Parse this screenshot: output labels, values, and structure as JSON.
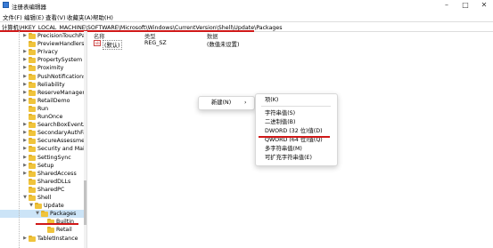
{
  "window": {
    "title": "注册表编辑器",
    "min": "–",
    "max": "□",
    "close": "✕"
  },
  "menu": [
    "文件(F)",
    "编辑(E)",
    "查看(V)",
    "收藏夹(A)",
    "帮助(H)"
  ],
  "address": "计算机\\HKEY_LOCAL_MACHINE\\SOFTWARE\\Microsoft\\Windows\\CurrentVersion\\Shell\\Update\\Packages",
  "tree": [
    {
      "label": "PrecisionTouchPad",
      "level": 3,
      "expandable": true
    },
    {
      "label": "PreviewHandlers",
      "level": 3,
      "expandable": false
    },
    {
      "label": "Privacy",
      "level": 3,
      "expandable": true
    },
    {
      "label": "PropertySystem",
      "level": 3,
      "expandable": true
    },
    {
      "label": "Proximity",
      "level": 3,
      "expandable": true
    },
    {
      "label": "PushNotifications",
      "level": 3,
      "expandable": true
    },
    {
      "label": "Reliability",
      "level": 3,
      "expandable": true
    },
    {
      "label": "ReserveManager",
      "level": 3,
      "expandable": true
    },
    {
      "label": "RetailDemo",
      "level": 3,
      "expandable": true
    },
    {
      "label": "Run",
      "level": 3,
      "expandable": false
    },
    {
      "label": "RunOnce",
      "level": 3,
      "expandable": false
    },
    {
      "label": "SearchBoxEventArgs",
      "level": 3,
      "expandable": true
    },
    {
      "label": "SecondaryAuthFactor",
      "level": 3,
      "expandable": true
    },
    {
      "label": "SecureAssessment",
      "level": 3,
      "expandable": true
    },
    {
      "label": "Security and Maint",
      "level": 3,
      "expandable": true
    },
    {
      "label": "SettingSync",
      "level": 3,
      "expandable": true
    },
    {
      "label": "Setup",
      "level": 3,
      "expandable": true
    },
    {
      "label": "SharedAccess",
      "level": 3,
      "expandable": true
    },
    {
      "label": "SharedDLLs",
      "level": 3,
      "expandable": false
    },
    {
      "label": "SharedPC",
      "level": 3,
      "expandable": false
    },
    {
      "label": "Shell",
      "level": 3,
      "expandable": true,
      "expanded": true
    },
    {
      "label": "Update",
      "level": 4,
      "expandable": true,
      "expanded": true
    },
    {
      "label": "Packages",
      "level": 5,
      "expandable": true,
      "expanded": true,
      "selected": true
    },
    {
      "label": "Builtin",
      "level": 6,
      "expandable": false
    },
    {
      "label": "Retail",
      "level": 6,
      "expandable": false
    },
    {
      "label": "TabletInstance",
      "level": 3,
      "expandable": true
    }
  ],
  "columns": [
    "名称",
    "类型",
    "数据"
  ],
  "values": [
    {
      "name": "(默认)",
      "type": "REG_SZ",
      "data": "(数值未设置)"
    }
  ],
  "context_menu": {
    "new_label": "新建(N)",
    "arrow": "›"
  },
  "submenu": {
    "items": [
      {
        "label": "项(K)",
        "sep_after": true
      },
      {
        "label": "字符串值(S)"
      },
      {
        "label": "二进制值(B)"
      },
      {
        "label": "DWORD (32 位)值(D)",
        "highlight": true
      },
      {
        "label": "QWORD (64 位)值(Q)"
      },
      {
        "label": "多字符串值(M)"
      },
      {
        "label": "可扩充字符串值(E)"
      }
    ]
  },
  "colors": {
    "highlight": "#d01818",
    "selected": "#cce4f7",
    "folder": "#f0c43c"
  }
}
